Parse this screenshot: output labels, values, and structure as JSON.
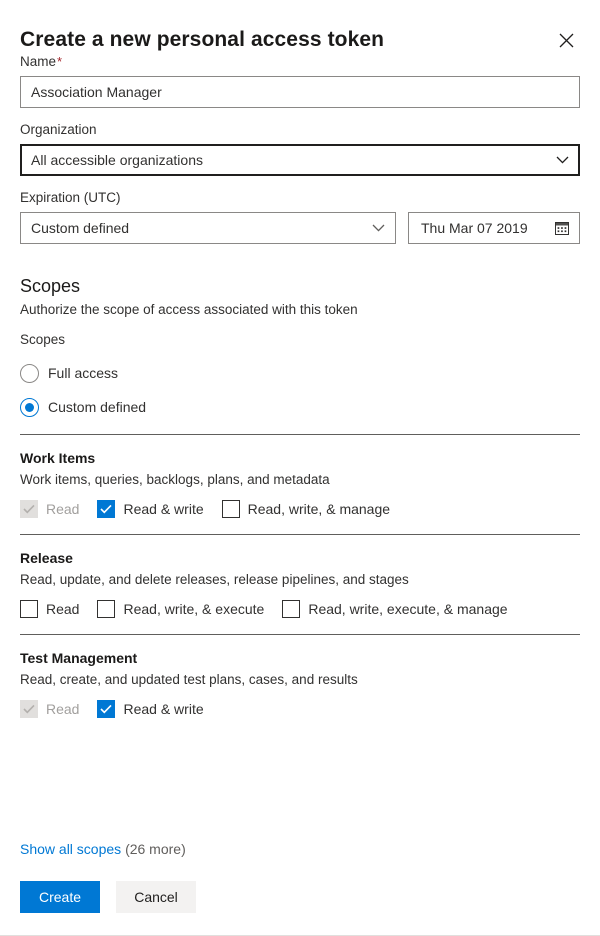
{
  "dialog": {
    "title": "Create a new personal access token",
    "close_icon": "close-icon"
  },
  "form": {
    "name": {
      "label": "Name",
      "required_marker": "*",
      "value": "Association Manager",
      "placeholder": ""
    },
    "organization": {
      "label": "Organization",
      "value": "All accessible organizations",
      "chevron_icon": "chevron-down-icon"
    },
    "expiration": {
      "label": "Expiration (UTC)",
      "preset_value": "Custom defined",
      "chevron_icon": "chevron-down-icon",
      "date_value": "Thu Mar 07 2019",
      "calendar_icon": "calendar-icon"
    }
  },
  "scopes": {
    "heading": "Scopes",
    "description": "Authorize the scope of access associated with this token",
    "legend": "Scopes",
    "options": [
      {
        "label": "Full access",
        "checked": false
      },
      {
        "label": "Custom defined",
        "checked": true
      }
    ],
    "groups": [
      {
        "name": "Work Items",
        "description": "Work items, queries, backlogs, plans, and metadata",
        "permissions": [
          {
            "label": "Read",
            "checked": true,
            "disabled": true
          },
          {
            "label": "Read & write",
            "checked": true,
            "disabled": false
          },
          {
            "label": "Read, write, & manage",
            "checked": false,
            "disabled": false
          }
        ]
      },
      {
        "name": "Release",
        "description": "Read, update, and delete releases, release pipelines, and stages",
        "permissions": [
          {
            "label": "Read",
            "checked": false,
            "disabled": false
          },
          {
            "label": "Read, write, & execute",
            "checked": false,
            "disabled": false
          },
          {
            "label": "Read, write, execute, & manage",
            "checked": false,
            "disabled": false
          }
        ]
      },
      {
        "name": "Test Management",
        "description": "Read, create, and updated test plans, cases, and results",
        "permissions": [
          {
            "label": "Read",
            "checked": true,
            "disabled": true
          },
          {
            "label": "Read & write",
            "checked": true,
            "disabled": false
          }
        ]
      }
    ]
  },
  "footer": {
    "show_all_link": "Show all scopes",
    "show_all_count": "(26 more)",
    "create_label": "Create",
    "cancel_label": "Cancel"
  },
  "colors": {
    "accent": "#0078d4",
    "required": "#a4262c",
    "disabled_fill": "#e1dfdd",
    "secondary_button": "#f3f2f1",
    "divider": "#605e5c"
  }
}
